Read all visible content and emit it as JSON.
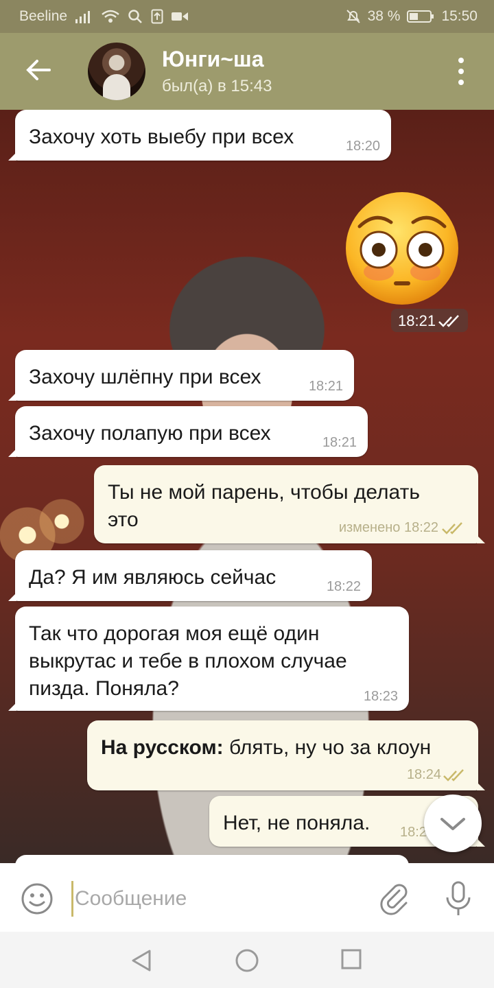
{
  "status_bar": {
    "carrier": "Beeline",
    "battery": "38 %",
    "time": "15:50"
  },
  "header": {
    "contact_name": "Юнги~ша",
    "last_seen": "был(а) в 15:43"
  },
  "messages": [
    {
      "dir": "in",
      "text": "Захочу хоть выебу при всех",
      "time": "18:20"
    },
    {
      "dir": "out",
      "type": "emoji",
      "emoji_name": "flushed-face",
      "time": "18:21"
    },
    {
      "dir": "in",
      "text": "Захочу шлёпну при всех",
      "time": "18:21"
    },
    {
      "dir": "in",
      "text": "Захочу полапую при всех",
      "time": "18:21"
    },
    {
      "dir": "out",
      "text_line1": "Ты не мой парень, чтобы делать",
      "text_line2": "это",
      "time": "изменено 18:22"
    },
    {
      "dir": "in",
      "text": "Да? Я им являюсь сейчас",
      "time": "18:22"
    },
    {
      "dir": "in",
      "text_line1": "Так что дорогая моя ещё один",
      "text_line2": "выкрутас и тебе в плохом случае",
      "text_line3": "пизда. Поняла?",
      "time": "18:23"
    },
    {
      "dir": "out",
      "bold_prefix": "На русском:",
      "text": " блять, ну чо за клоун",
      "time": "18:24"
    },
    {
      "dir": "out",
      "text": "Нет, не поняла.",
      "time": "18:2"
    }
  ],
  "input": {
    "placeholder": "Сообщение"
  },
  "colors": {
    "header": "#9d9b6d",
    "status_bar": "#8b8660",
    "incoming_bubble": "#ffffff",
    "outgoing_bubble": "#fbf8e8",
    "read_check": "#c9b96a"
  }
}
